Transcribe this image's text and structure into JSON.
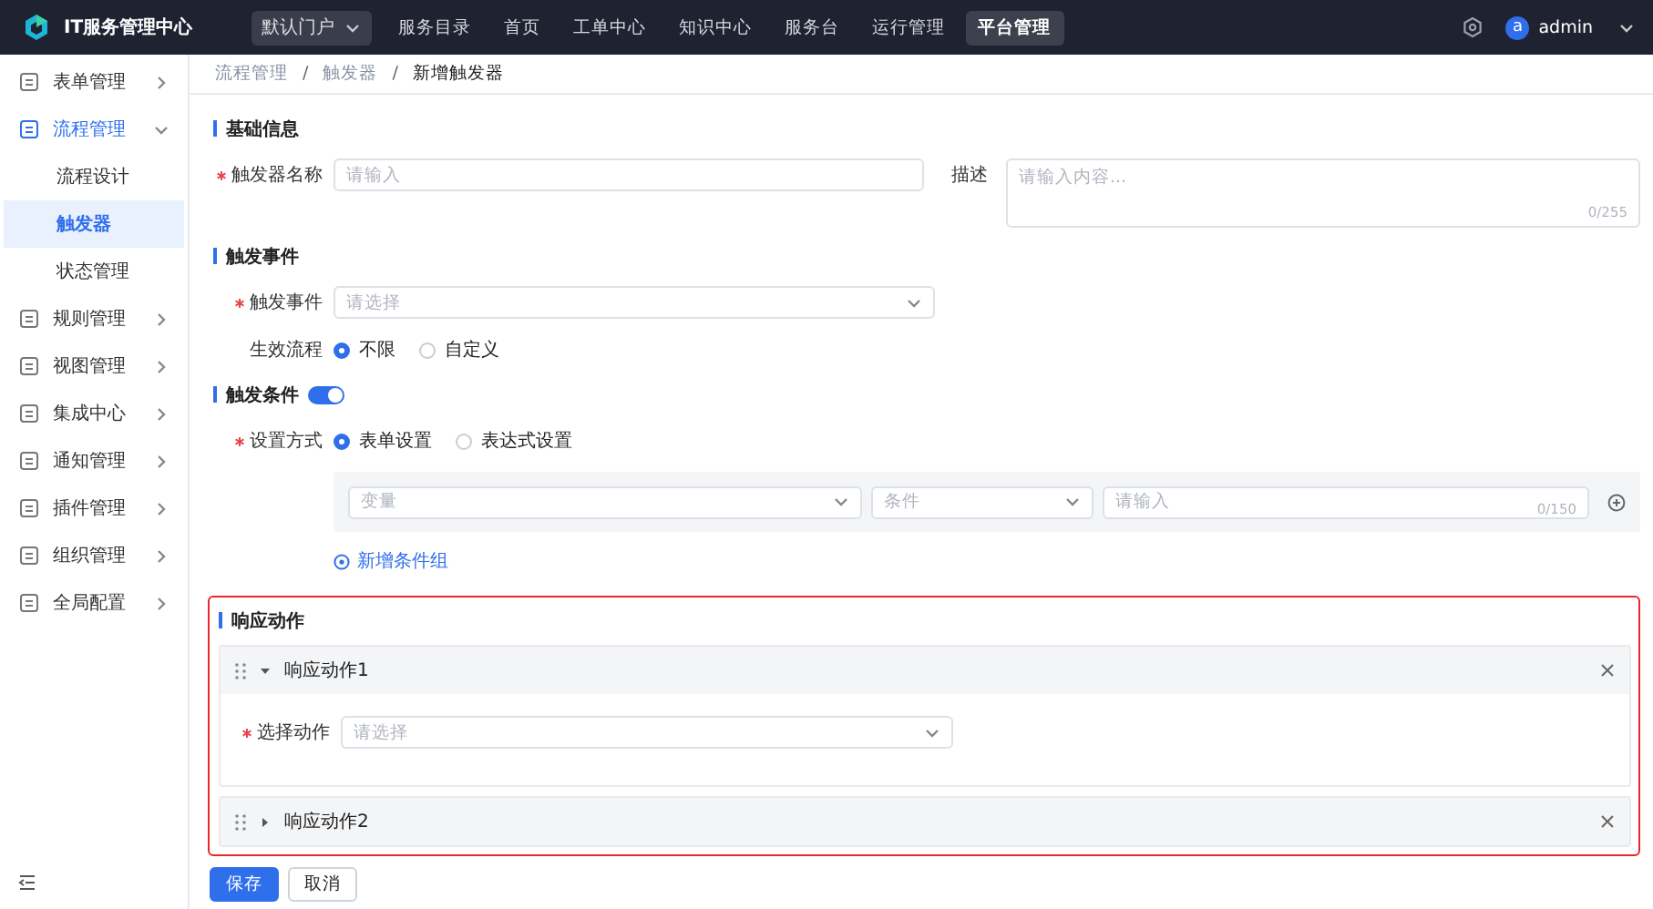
{
  "header": {
    "app_title": "IT服务管理中心",
    "portal_select": {
      "value": "默认门户"
    },
    "nav": [
      {
        "label": "服务目录",
        "selected": false
      },
      {
        "label": "首页",
        "selected": false
      },
      {
        "label": "工单中心",
        "selected": false
      },
      {
        "label": "知识中心",
        "selected": false
      },
      {
        "label": "服务台",
        "selected": false
      },
      {
        "label": "运行管理",
        "selected": false
      },
      {
        "label": "平台管理",
        "selected": true
      }
    ],
    "user": {
      "avatar": "a",
      "name": "admin"
    }
  },
  "sidebar": {
    "items": [
      {
        "label": "表单管理",
        "expanded": false,
        "selected": false
      },
      {
        "label": "流程管理",
        "expanded": true,
        "selected": true,
        "children": [
          {
            "label": "流程设计",
            "selected": false
          },
          {
            "label": "触发器",
            "selected": true
          },
          {
            "label": "状态管理",
            "selected": false
          }
        ]
      },
      {
        "label": "规则管理",
        "expanded": false,
        "selected": false
      },
      {
        "label": "视图管理",
        "expanded": false,
        "selected": false
      },
      {
        "label": "集成中心",
        "expanded": false,
        "selected": false
      },
      {
        "label": "通知管理",
        "expanded": false,
        "selected": false
      },
      {
        "label": "插件管理",
        "expanded": false,
        "selected": false
      },
      {
        "label": "组织管理",
        "expanded": false,
        "selected": false
      },
      {
        "label": "全局配置",
        "expanded": false,
        "selected": false
      }
    ]
  },
  "breadcrumb": {
    "separator": "/",
    "items": [
      "流程管理",
      "触发器",
      "新增触发器"
    ]
  },
  "form": {
    "sections": [
      {
        "title": "基础信息",
        "highlighted": false,
        "rows": [
          [
            {
              "kind": "input",
              "label": "触发器名称",
              "required": true,
              "placeholder": "请输入"
            },
            {
              "kind": "textarea",
              "label": "描述",
              "required": false,
              "placeholder": "请输入内容...",
              "counter": "0/255"
            }
          ]
        ]
      },
      {
        "title": "触发事件",
        "highlighted": false,
        "rows": [
          [
            {
              "kind": "select",
              "label": "触发事件",
              "required": true,
              "placeholder": "请选择"
            }
          ],
          [
            {
              "kind": "radio",
              "label": "生效流程",
              "required": false,
              "options": [
                {
                  "label": "不限",
                  "selected": true
                },
                {
                  "label": "自定义",
                  "selected": false
                }
              ]
            }
          ]
        ]
      },
      {
        "title": "触发条件",
        "highlighted": false,
        "toggle": {
          "on": true
        },
        "rows": [
          [
            {
              "kind": "radio",
              "label": "设置方式",
              "required": true,
              "options": [
                {
                  "label": "表单设置",
                  "selected": true
                },
                {
                  "label": "表达式设置",
                  "selected": false
                }
              ]
            }
          ],
          [
            {
              "kind": "condition",
              "variable": "变量",
              "operator": "条件",
              "value_placeholder": "请输入",
              "counter": "0/150"
            }
          ],
          [
            {
              "kind": "link",
              "text": "新增条件组"
            }
          ]
        ]
      },
      {
        "title": "响应动作",
        "highlighted": true,
        "actions": [
          {
            "title": "响应动作1",
            "expanded": true,
            "fields": [
              {
                "kind": "select",
                "label": "选择动作",
                "required": true,
                "placeholder": "请选择"
              }
            ]
          },
          {
            "title": "响应动作2",
            "expanded": false
          }
        ]
      }
    ]
  },
  "buttons": [
    {
      "label": "保存",
      "kind": "primary"
    },
    {
      "label": "取消",
      "kind": "default"
    }
  ]
}
